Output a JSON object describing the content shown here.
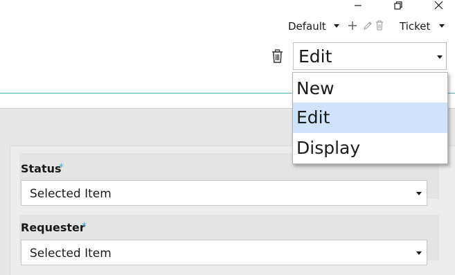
{
  "window": {
    "minimize_icon": "minimize-icon",
    "restore_icon": "restore-icon",
    "close_icon": "close-icon"
  },
  "toolbar": {
    "view_label": "Default",
    "add_icon": "plus-icon",
    "edit_icon": "pencil-icon",
    "delete_icon": "trash-icon",
    "entity_label": "Ticket"
  },
  "form_mode": {
    "delete_icon": "trash-icon",
    "selected": "Edit",
    "options": [
      "New",
      "Edit",
      "Display"
    ],
    "highlighted": "Edit"
  },
  "form": {
    "fields": [
      {
        "label": "Status",
        "required_mark": "*",
        "value": "Selected Item"
      },
      {
        "label": "Requester",
        "required_mark": "*",
        "value": "Selected Item"
      }
    ]
  },
  "colors": {
    "accent_line": "#46b3c6",
    "required": "#4aa8d6",
    "highlight": "#cfe4fa",
    "panel": "#e7e7e7"
  }
}
